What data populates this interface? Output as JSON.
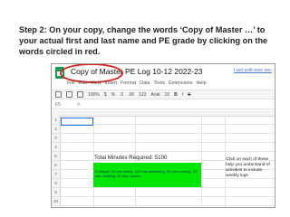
{
  "instruction": {
    "text": "Step 2: On your copy, change the words ‘Copy of Master …’ to your actual first and last name and PE grade by clicking on the words circled in red."
  },
  "sheet": {
    "title": "Copy of Master PE Log 10-12 2022-23",
    "last_edit": "Last edit was sec",
    "menu": [
      "File",
      "Edit",
      "View",
      "Insert",
      "Format",
      "Data",
      "Tools",
      "Extensions",
      "Help"
    ],
    "toolbar": {
      "zoom": "100%",
      "currency": "$",
      "percent": "%",
      "decimal_less": ".0",
      "decimal_more": ".00",
      "format_more": "123",
      "font": "Arial",
      "font_size": "10",
      "bold": "B",
      "italic": "I",
      "strike": "S"
    },
    "formula_bar": {
      "cell_ref": "F5",
      "fx": "fx"
    },
    "row_numbers": [
      "1",
      "2",
      "3",
      "4",
      "5",
      "6",
      "7",
      "8",
      "9",
      "10"
    ],
    "total_minutes": "Total Minutes Required: 5100",
    "example": "Example: 30 min hiking, 120 min swimming, 60 min running, 30 min, walking, 45 min, soccer",
    "side_note": "Click on each of these help you understand of activities to include weekly logs"
  },
  "colors": {
    "highlight": "#e0201a",
    "green": "#00e600",
    "sheets": "#0f9d58"
  }
}
